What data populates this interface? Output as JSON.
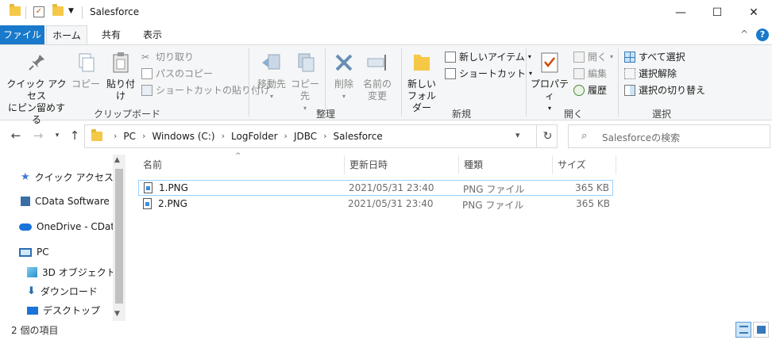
{
  "window": {
    "title": "Salesforce",
    "minimize": "—",
    "maximize": "☐",
    "close": "✕"
  },
  "ribbon_tabs": [
    "ファイル",
    "ホーム",
    "共有",
    "表示"
  ],
  "ribbon_controls": {
    "collapse": "^",
    "help": "?"
  },
  "ribbon": {
    "clipboard": {
      "label": "クリップボード",
      "pin_line1": "クイック アクセス",
      "pin_line2": "にピン留めする",
      "copy": "コピー",
      "paste": "貼り付け",
      "cut": "切り取り",
      "copy_path": "パスのコピー",
      "paste_shortcut": "ショートカットの貼り付け"
    },
    "organize": {
      "label": "整理",
      "move_line1": "移動先",
      "copy_line1": "コピー先",
      "delete": "削除",
      "rename_line1": "名前の",
      "rename_line2": "変更"
    },
    "new": {
      "label": "新規",
      "new_folder_line1": "新しい",
      "new_folder_line2": "フォルダー",
      "new_item": "新しいアイテム",
      "shortcut": "ショートカット"
    },
    "open": {
      "label": "開く",
      "properties": "プロパティ",
      "open": "開く",
      "edit": "編集",
      "history": "履歴"
    },
    "select": {
      "label": "選択",
      "select_all": "すべて選択",
      "select_none": "選択解除",
      "invert": "選択の切り替え"
    }
  },
  "address": {
    "crumbs": [
      "PC",
      "Windows (C:)",
      "LogFolder",
      "JDBC",
      "Salesforce"
    ],
    "search_placeholder": "Salesforceの検索"
  },
  "nav": {
    "items": [
      "クイック アクセス",
      "CData Software",
      "OneDrive - CData",
      "PC",
      "3D オブジェクト",
      "ダウンロード",
      "デスクトップ"
    ]
  },
  "columns": [
    "名前",
    "更新日時",
    "種類",
    "サイズ"
  ],
  "files": [
    {
      "name": "1.PNG",
      "modified": "2021/05/31 23:40",
      "type": "PNG ファイル",
      "size": "365 KB"
    },
    {
      "name": "2.PNG",
      "modified": "2021/05/31 23:40",
      "type": "PNG ファイル",
      "size": "365 KB"
    }
  ],
  "status": {
    "count": "2 個の項目"
  },
  "colors": {
    "accent": "#1979ca",
    "ribbon_bg": "#f5f6f7",
    "selection_border": "#99d1ff",
    "folder": "#f5c847"
  }
}
